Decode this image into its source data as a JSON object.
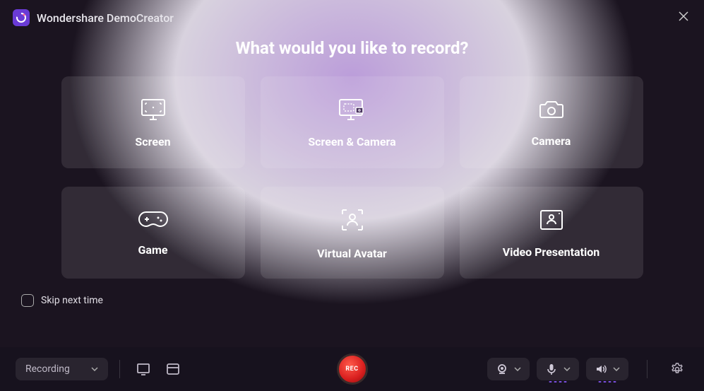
{
  "app": {
    "title": "Wondershare DemoCreator"
  },
  "heading": "What would you like to record?",
  "cards": [
    {
      "label": "Screen"
    },
    {
      "label": "Screen & Camera"
    },
    {
      "label": "Camera"
    },
    {
      "label": "Game"
    },
    {
      "label": "Virtual Avatar"
    },
    {
      "label": "Video Presentation"
    }
  ],
  "skip": {
    "label": "Skip next time"
  },
  "bottombar": {
    "mode_label": "Recording",
    "rec_label": "REC"
  }
}
